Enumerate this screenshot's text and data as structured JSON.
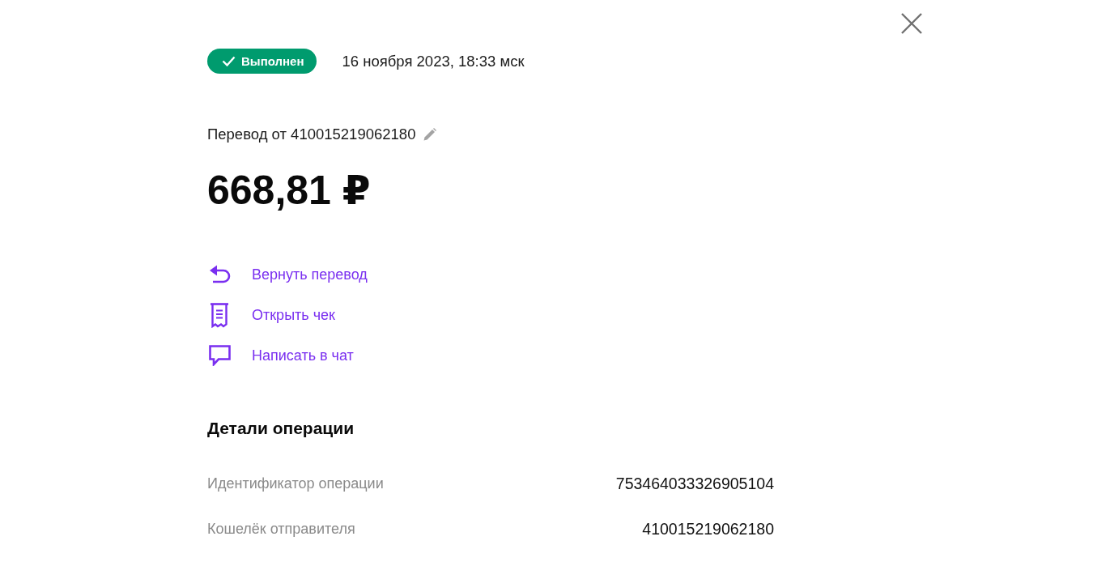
{
  "status": {
    "kind": "success",
    "label": "Выполнен"
  },
  "date": "16 ноября 2023, 18:33 мск",
  "title": {
    "text": "Перевод от 410015219062180",
    "editable": true
  },
  "amount": "668,81 ₽",
  "actions": [
    {
      "kind": "return",
      "label": "Вернуть перевод"
    },
    {
      "kind": "receipt",
      "label": "Открыть чек"
    },
    {
      "kind": "chat",
      "label": "Написать в чат"
    }
  ],
  "details": {
    "title": "Детали операции",
    "rows": [
      {
        "label": "Идентификатор операции",
        "value": "753464033326905104"
      },
      {
        "label": "Кошелёк отправителя",
        "value": "410015219062180"
      }
    ]
  }
}
